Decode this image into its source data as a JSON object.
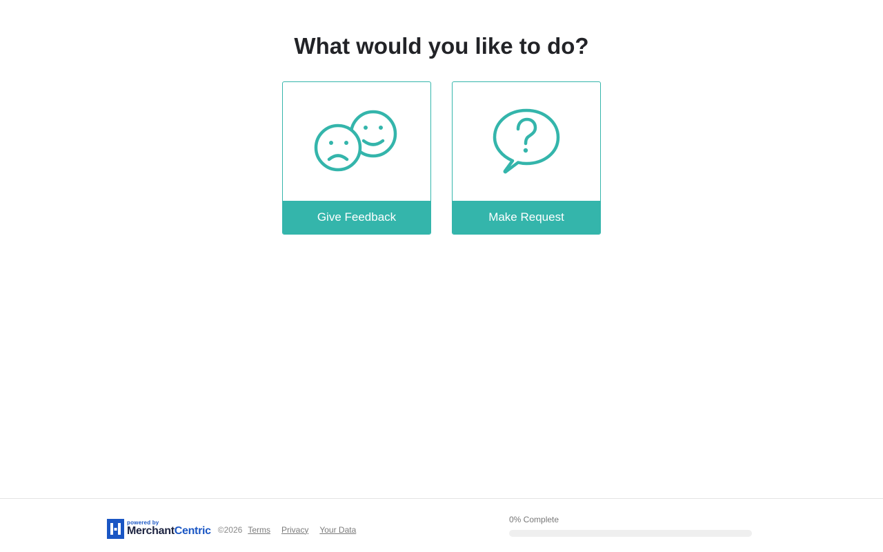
{
  "main": {
    "title": "What would you like to do?",
    "options": [
      {
        "label": "Give Feedback",
        "icon": "feedback-faces-icon"
      },
      {
        "label": "Make Request",
        "icon": "question-bubble-icon"
      }
    ]
  },
  "footer": {
    "logo": {
      "powered_by": "powered by",
      "brand_part1": "Merchant",
      "brand_part2": "Centric"
    },
    "copyright": "©2026",
    "links": [
      "Terms",
      "Privacy",
      "Your Data"
    ],
    "progress": {
      "label": "0% Complete",
      "percent": 0
    }
  },
  "colors": {
    "accent": "#34b5ab",
    "brand": "#1a56c4"
  }
}
